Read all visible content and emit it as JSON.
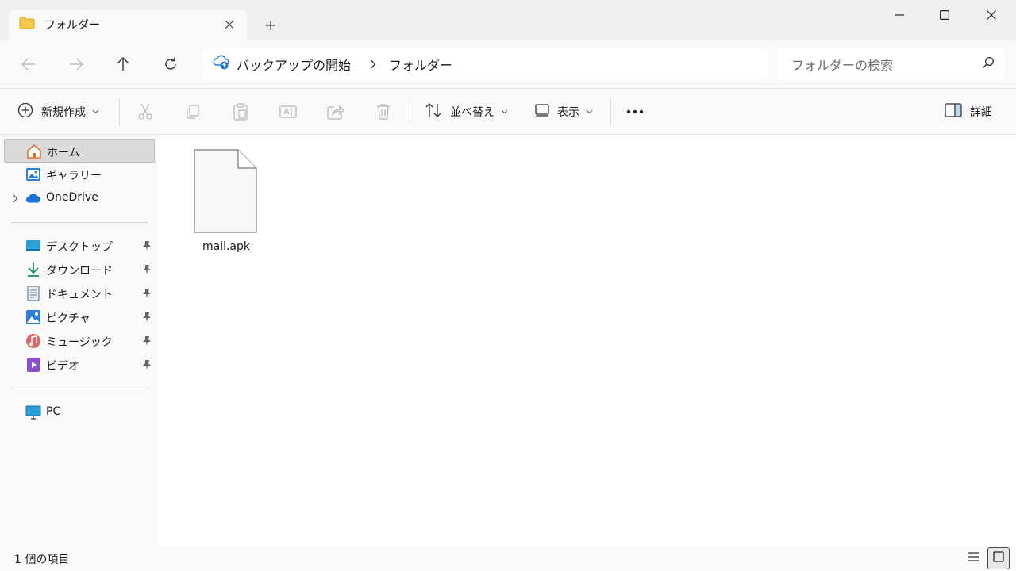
{
  "window": {
    "tab_title": "フォルダー",
    "new_tab_symbol": "+"
  },
  "address": {
    "crumbs": [
      "バックアップの開始",
      "フォルダー"
    ]
  },
  "search": {
    "placeholder": "フォルダーの検索"
  },
  "toolbar": {
    "new_label": "新規作成",
    "sort_label": "並べ替え",
    "view_label": "表示",
    "details_label": "詳細"
  },
  "sidebar": {
    "top_items": [
      {
        "label": "ホーム",
        "icon": "home-icon",
        "selected": true
      },
      {
        "label": "ギャラリー",
        "icon": "gallery-icon"
      },
      {
        "label": "OneDrive",
        "icon": "onedrive-icon"
      }
    ],
    "pinned_items": [
      {
        "label": "デスクトップ",
        "icon": "desktop-icon"
      },
      {
        "label": "ダウンロード",
        "icon": "download-icon"
      },
      {
        "label": "ドキュメント",
        "icon": "documents-icon"
      },
      {
        "label": "ピクチャ",
        "icon": "pictures-icon"
      },
      {
        "label": "ミュージック",
        "icon": "music-icon"
      },
      {
        "label": "ビデオ",
        "icon": "videos-icon"
      }
    ],
    "bottom_items": [
      {
        "label": "PC",
        "icon": "pc-icon"
      }
    ]
  },
  "files": [
    {
      "name": "mail.apk",
      "icon": "file-icon"
    }
  ],
  "status": {
    "item_count": "1 個の項目"
  },
  "colors": {
    "chrome_bg": "#efefef",
    "pane_bg": "#f9f9f9",
    "selected_bg": "#dadada",
    "accent_blue": "#1a73d9",
    "folder_yellow": "#f7c948"
  }
}
